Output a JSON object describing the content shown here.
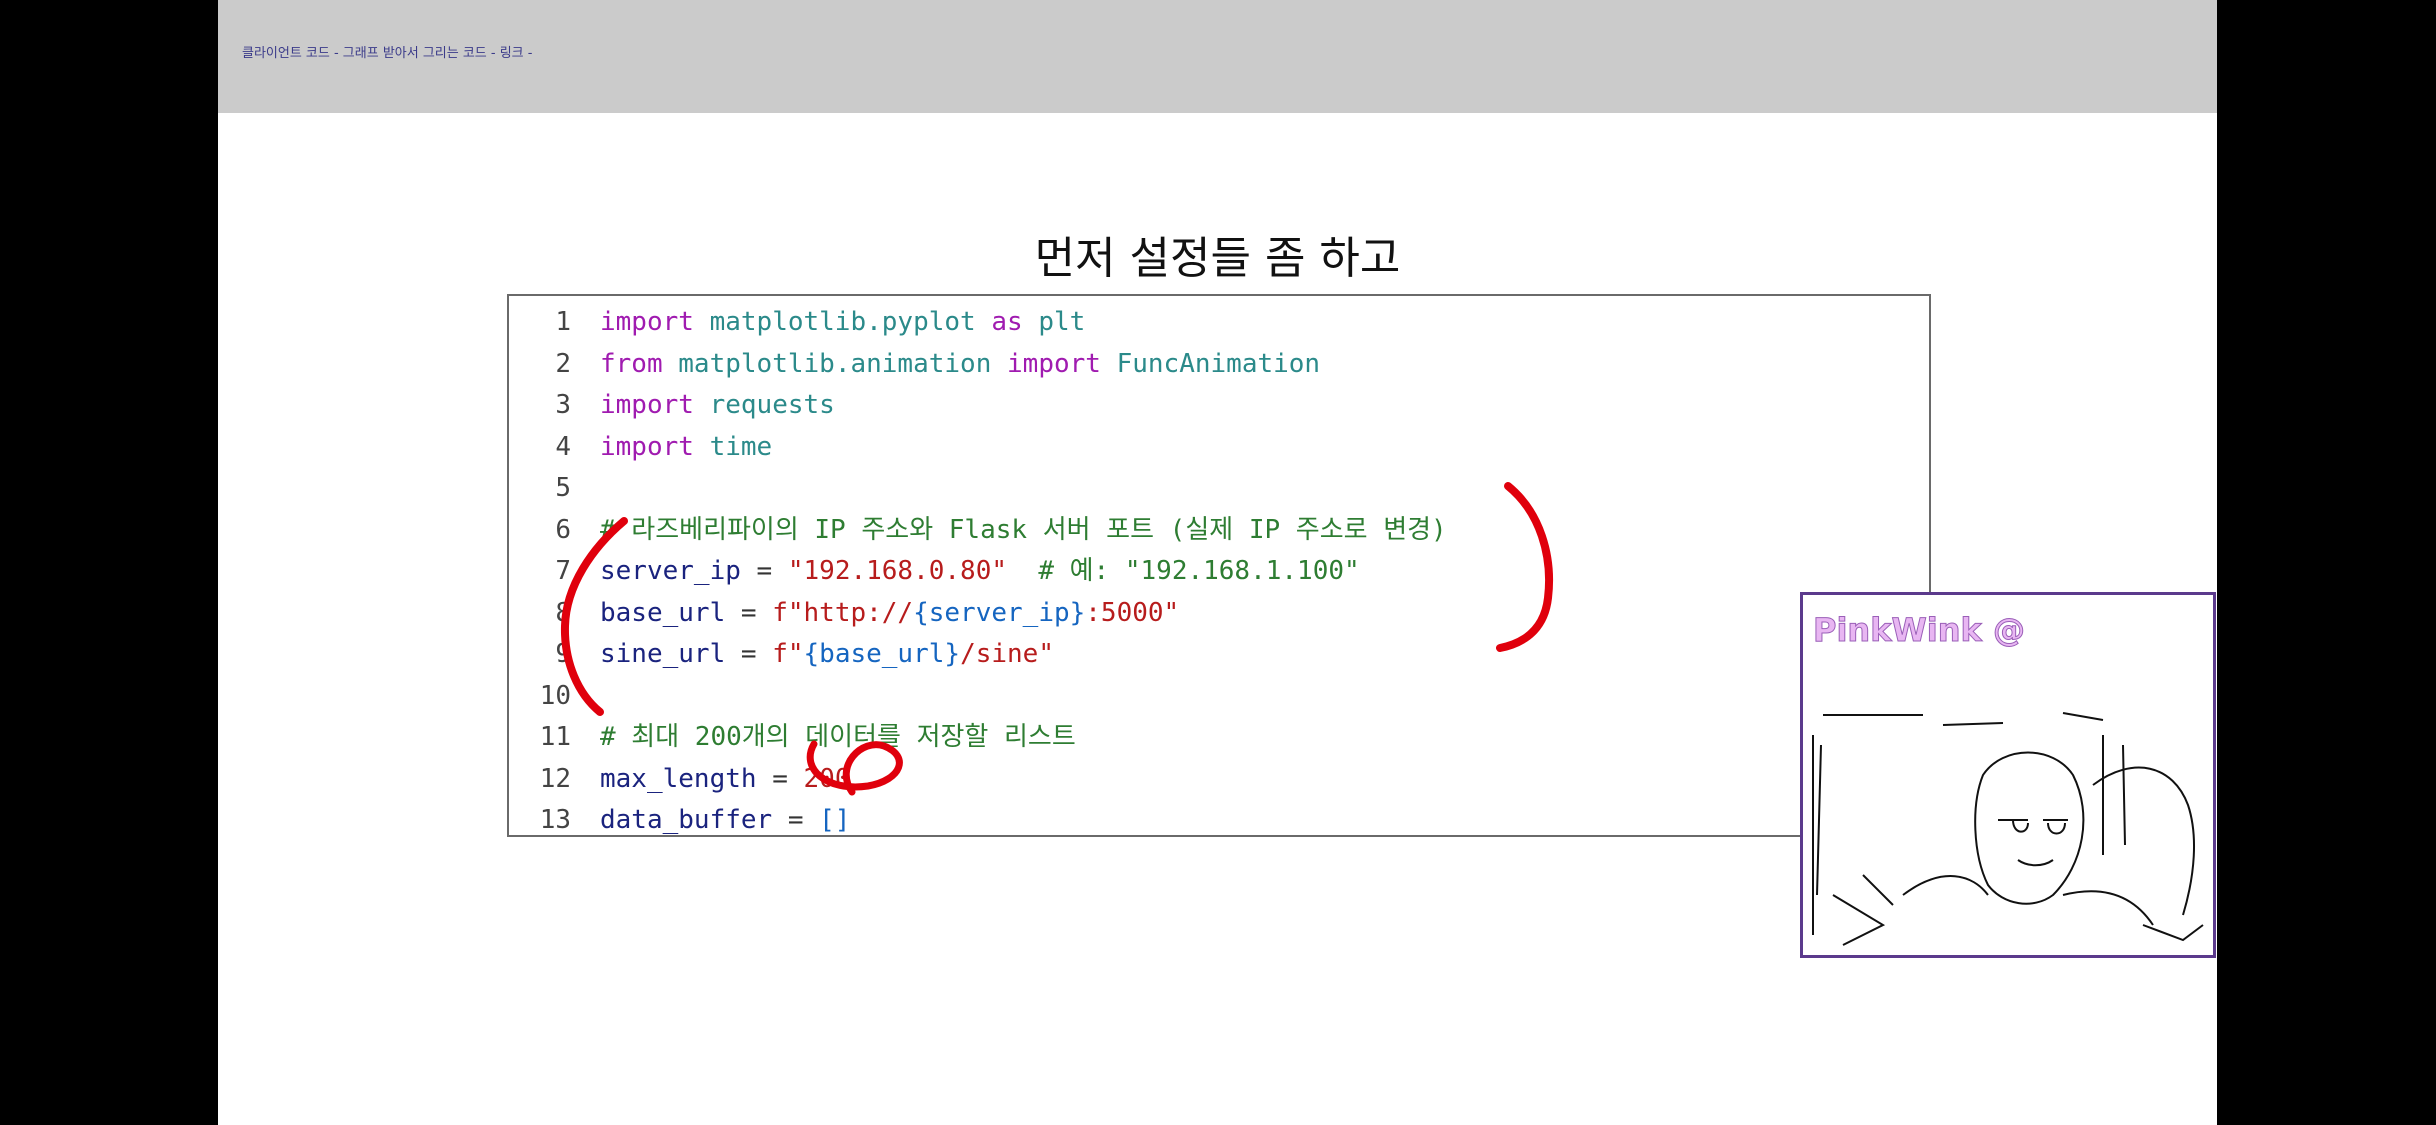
{
  "header": {
    "breadcrumb": "클라이언트 코드 - 그래프 받아서 그리는 코드 - 링크 -"
  },
  "slide": {
    "title": "먼저 설정들 좀 하고"
  },
  "code": {
    "lines": [
      {
        "num": "1",
        "tokens": [
          [
            "kw",
            "import"
          ],
          [
            "op",
            " "
          ],
          [
            "mod",
            "matplotlib.pyplot"
          ],
          [
            "op",
            " "
          ],
          [
            "kw",
            "as"
          ],
          [
            "op",
            " "
          ],
          [
            "mod",
            "plt"
          ]
        ]
      },
      {
        "num": "2",
        "tokens": [
          [
            "kw",
            "from"
          ],
          [
            "op",
            " "
          ],
          [
            "mod",
            "matplotlib.animation"
          ],
          [
            "op",
            " "
          ],
          [
            "kw",
            "import"
          ],
          [
            "op",
            " "
          ],
          [
            "mod",
            "FuncAnimation"
          ]
        ]
      },
      {
        "num": "3",
        "tokens": [
          [
            "kw",
            "import"
          ],
          [
            "op",
            " "
          ],
          [
            "mod",
            "requests"
          ]
        ]
      },
      {
        "num": "4",
        "tokens": [
          [
            "kw",
            "import"
          ],
          [
            "op",
            " "
          ],
          [
            "mod",
            "time"
          ]
        ]
      },
      {
        "num": "5",
        "tokens": []
      },
      {
        "num": "6",
        "tokens": [
          [
            "com",
            "# 라즈베리파이의 IP 주소와 Flask 서버 포트 (실제 IP 주소로 변경)"
          ]
        ]
      },
      {
        "num": "7",
        "tokens": [
          [
            "id",
            "server_ip"
          ],
          [
            "op",
            " = "
          ],
          [
            "str",
            "\"192.168.0.80\""
          ],
          [
            "op",
            "  "
          ],
          [
            "com",
            "# 예: \"192.168.1.100\""
          ]
        ]
      },
      {
        "num": "8",
        "tokens": [
          [
            "id",
            "base_url"
          ],
          [
            "op",
            " = "
          ],
          [
            "str",
            "f\"http://"
          ],
          [
            "fx",
            "{server_ip}"
          ],
          [
            "str",
            ":5000\""
          ]
        ]
      },
      {
        "num": "9",
        "tokens": [
          [
            "id",
            "sine_url"
          ],
          [
            "op",
            " = "
          ],
          [
            "str",
            "f\""
          ],
          [
            "fx",
            "{base_url}"
          ],
          [
            "str",
            "/sine\""
          ]
        ]
      },
      {
        "num": "10",
        "tokens": []
      },
      {
        "num": "11",
        "tokens": [
          [
            "com",
            "# 최대 200개의 데이터를 저장할 리스트"
          ]
        ]
      },
      {
        "num": "12",
        "tokens": [
          [
            "id",
            "max_length"
          ],
          [
            "op",
            " = "
          ],
          [
            "str",
            "200"
          ]
        ]
      },
      {
        "num": "13",
        "tokens": [
          [
            "id",
            "data_buffer"
          ],
          [
            "op",
            " = "
          ],
          [
            "fx",
            "[]"
          ]
        ]
      }
    ]
  },
  "webcam": {
    "brand": "PinkWink @"
  },
  "colors": {
    "annotation_red": "#e0000c",
    "webcam_border": "#5b3a8c",
    "topbar": "#cbcbcb"
  }
}
